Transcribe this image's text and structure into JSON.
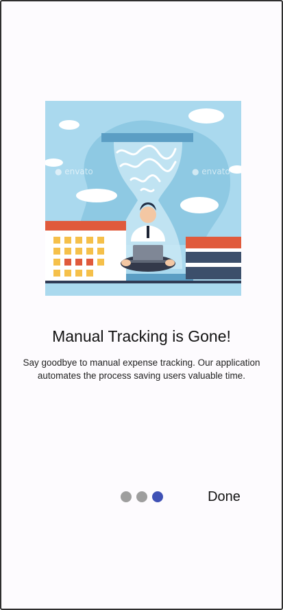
{
  "onboarding": {
    "title": "Manual Tracking is Gone!",
    "description": "Say goodbye to manual expense tracking. Our application automates the process saving users valuable time.",
    "done_label": "Done",
    "watermark_text": "envato",
    "illustration_name": "hourglass-person-laptop-illustration"
  },
  "pager": {
    "total": 3,
    "active_index": 2,
    "active_color": "#3f51b5",
    "inactive_color": "#9e9e9e"
  },
  "colors": {
    "sky": "#a8d8ec",
    "calendar_header": "#e05a3c",
    "calendar_cell": "#f5c04a",
    "calendar_cell_alt": "#e05a3c"
  }
}
